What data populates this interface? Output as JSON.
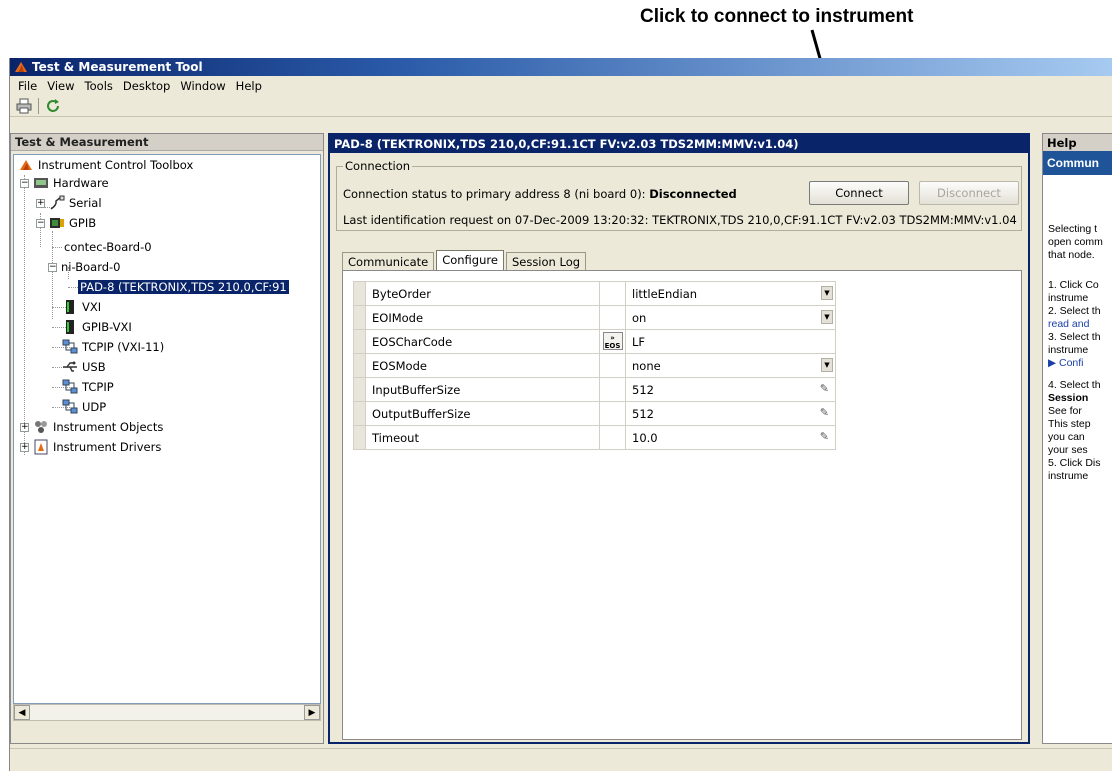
{
  "annotation": "Click to connect to instrument",
  "window": {
    "title": "Test & Measurement Tool",
    "menu": [
      "File",
      "View",
      "Tools",
      "Desktop",
      "Window",
      "Help"
    ]
  },
  "left_panel": {
    "title": "Test & Measurement",
    "tree": [
      {
        "label": "Instrument Control Toolbox",
        "icon": "matlab-icon"
      },
      {
        "label": "Hardware",
        "icon": "hardware-icon"
      },
      {
        "label": "Serial",
        "icon": "serial-icon"
      },
      {
        "label": "GPIB",
        "icon": "gpib-icon"
      },
      {
        "label": "contec-Board-0",
        "icon": ""
      },
      {
        "label": "ni-Board-0",
        "icon": ""
      },
      {
        "label": "PAD-8 (TEKTRONIX,TDS 210,0,CF:91",
        "icon": ""
      },
      {
        "label": "VXI",
        "icon": "vxi-icon"
      },
      {
        "label": "GPIB-VXI",
        "icon": "gpib-vxi-icon"
      },
      {
        "label": "TCPIP (VXI-11)",
        "icon": "network-icon"
      },
      {
        "label": "USB",
        "icon": "usb-icon"
      },
      {
        "label": "TCPIP",
        "icon": "network-icon"
      },
      {
        "label": "UDP",
        "icon": "network-icon"
      },
      {
        "label": "Instrument Objects",
        "icon": "objects-icon"
      },
      {
        "label": "Instrument Drivers",
        "icon": "drivers-icon"
      }
    ]
  },
  "center_panel": {
    "title": "PAD-8 (TEKTRONIX,TDS 210,0,CF:91.1CT FV:v2.03 TDS2MM:MMV:v1.04)",
    "connection": {
      "legend": "Connection",
      "status_prefix": "Connection status to primary address 8 (ni board 0): ",
      "status_value": "Disconnected",
      "last_id": "Last identification request on 07-Dec-2009 13:20:32: TEKTRONIX,TDS 210,0,CF:91.1CT FV:v2.03 TDS2MM:MMV:v1.04",
      "connect_label": "Connect",
      "disconnect_label": "Disconnect"
    },
    "tabs": [
      "Communicate",
      "Configure",
      "Session Log"
    ],
    "active_tab": "Configure",
    "properties": [
      {
        "name": "ByteOrder",
        "value": "littleEndian",
        "editor": "dropdown"
      },
      {
        "name": "EOIMode",
        "value": "on",
        "editor": "dropdown"
      },
      {
        "name": "EOSCharCode",
        "value": "LF",
        "editor": "eos"
      },
      {
        "name": "EOSMode",
        "value": "none",
        "editor": "dropdown"
      },
      {
        "name": "InputBufferSize",
        "value": "512",
        "editor": "text"
      },
      {
        "name": "OutputBufferSize",
        "value": "512",
        "editor": "text"
      },
      {
        "name": "Timeout",
        "value": "10.0",
        "editor": "text"
      }
    ],
    "eos_button": "EOS"
  },
  "help_panel": {
    "title": "Help",
    "heading": "Commun",
    "intro": [
      "Selecting t",
      "open comm",
      "that node."
    ],
    "steps": [
      {
        "lines": [
          "1. Click Co",
          "instrume"
        ]
      },
      {
        "lines": [
          "2. Select th",
          "read and"
        ]
      },
      {
        "lines": [
          "3. Select th",
          "instrume",
          "▶ Confi"
        ]
      },
      {
        "lines": [
          "4. Select th",
          "Session",
          "See for",
          "This step",
          "you can",
          "your ses"
        ]
      },
      {
        "lines": [
          "5. Click Dis",
          "instrume"
        ]
      }
    ]
  }
}
